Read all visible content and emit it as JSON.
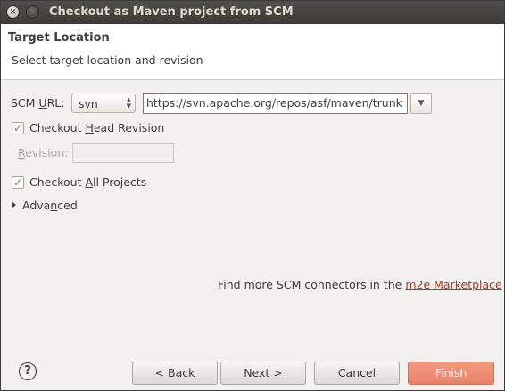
{
  "window": {
    "title": "Checkout as Maven project from SCM",
    "close_glyph": "×",
    "minimize_glyph": "–"
  },
  "header": {
    "title": "Target Location",
    "subtitle": "Select target location and revision"
  },
  "scm": {
    "label": "SCM URL:",
    "type_value": "svn",
    "url_value": "https://svn.apache.org/repos/asf/maven/trunk"
  },
  "options": {
    "checkout_head_label": "Checkout Head Revision",
    "checkout_head_checked": true,
    "revision_label": "Revision:",
    "revision_value": "",
    "checkout_all_label": "Checkout All Projects",
    "checkout_all_checked": true,
    "advanced_label": "Advanced"
  },
  "footer": {
    "marketplace_prefix": "Find more SCM connectors in the",
    "marketplace_link": "m2e Marketplace",
    "help_glyph": "?"
  },
  "buttons": {
    "back": "< Back",
    "next": "Next >",
    "cancel": "Cancel",
    "finish": "Finish"
  },
  "colors": {
    "accent": "#e8826a",
    "link": "#a53e1f",
    "check": "#e0582b"
  }
}
